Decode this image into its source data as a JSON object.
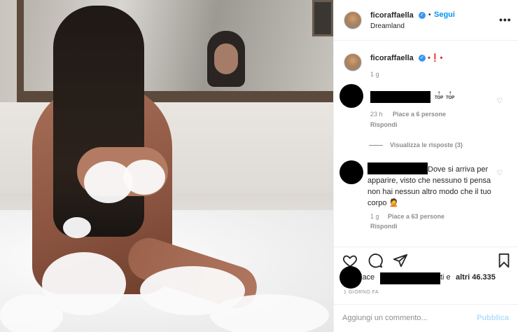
{
  "post_header": {
    "username": "ficoraffaella",
    "verified_mark": "✓",
    "separator": "•",
    "follow_label": "Segui",
    "location": "Dreamland",
    "more_icon": "•••"
  },
  "caption": {
    "username": "ficoraffaella",
    "text_tail": "•❗•",
    "time_ago": "1 g"
  },
  "comments": [
    {
      "text": "",
      "top_badges": [
        "TOP",
        "TOP"
      ],
      "time_ago": "23 h",
      "likes": "Piace a 6 persone",
      "reply_label": "Rispondi",
      "view_replies_label": "Visualizza le risposte (3)"
    },
    {
      "text": "Dove si arriva per apparire, visto che nessuno ti pensa non hai nessun altro modo che il tuo corpo 🤦",
      "time_ago": "1 g",
      "likes": "Piace a 63 persone",
      "reply_label": "Rispondi"
    }
  ],
  "actions": {
    "like_icon": "heart-icon",
    "comment_icon": "comment-icon",
    "share_icon": "share-icon",
    "save_icon": "bookmark-icon"
  },
  "likes_summary": {
    "prefix": "iace",
    "suffix": "ti e",
    "others": "altri 46.335"
  },
  "post_date": "1 GIORNO FA",
  "add_comment": {
    "placeholder": "Aggiungi un commento...",
    "publish_label": "Pubblica"
  },
  "colors": {
    "link_blue": "#0095f6",
    "publish_disabled": "#b2dffc",
    "muted_gray": "#8e8e8e",
    "verified_blue": "#3897f0",
    "caption_emoji_red": "#e0242e"
  }
}
